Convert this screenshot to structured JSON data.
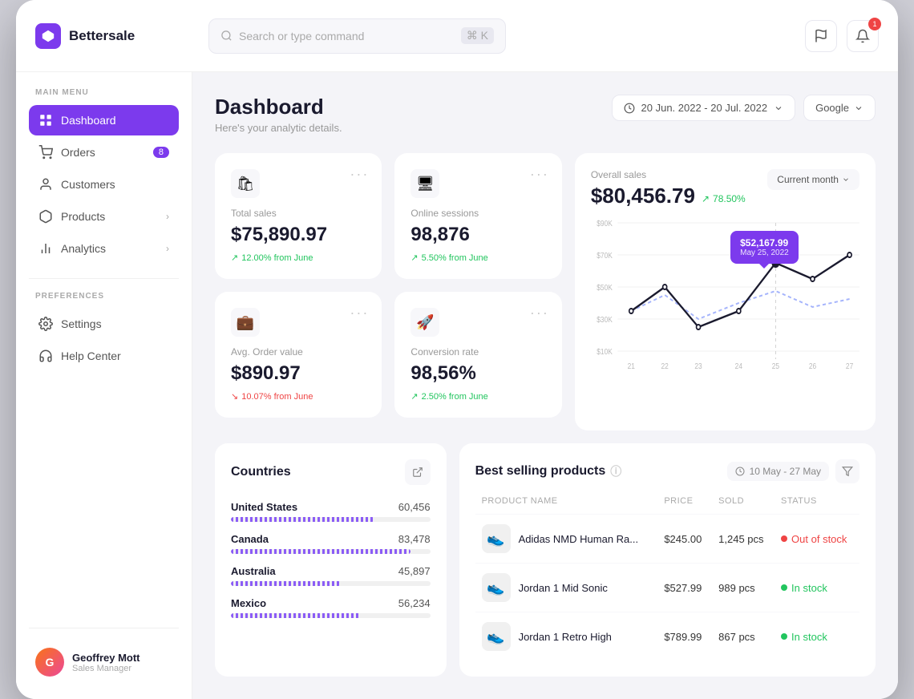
{
  "app": {
    "name": "Bettersale"
  },
  "header": {
    "search_placeholder": "Search or type command",
    "search_shortcut": "⌘ K",
    "date_range": "20 Jun. 2022 - 20 Jul. 2022",
    "source": "Google"
  },
  "sidebar": {
    "main_menu_label": "MAIN MENU",
    "preferences_label": "PREFERENCES",
    "items": [
      {
        "id": "dashboard",
        "label": "Dashboard",
        "active": true,
        "badge": null
      },
      {
        "id": "orders",
        "label": "Orders",
        "active": false,
        "badge": "8"
      },
      {
        "id": "customers",
        "label": "Customers",
        "active": false,
        "badge": null
      },
      {
        "id": "products",
        "label": "Products",
        "active": false,
        "badge": null
      },
      {
        "id": "analytics",
        "label": "Analytics",
        "active": false,
        "badge": null
      }
    ],
    "pref_items": [
      {
        "id": "settings",
        "label": "Settings"
      },
      {
        "id": "help",
        "label": "Help Center"
      }
    ],
    "user": {
      "name": "Geoffrey Mott",
      "role": "Sales Manager"
    }
  },
  "page": {
    "title": "Dashboard",
    "subtitle": "Here's your analytic details."
  },
  "stats": [
    {
      "id": "total-sales",
      "label": "Total sales",
      "value": "$75,890.97",
      "change": "12.00% from June",
      "direction": "up",
      "icon": "🛍"
    },
    {
      "id": "online-sessions",
      "label": "Online sessions",
      "value": "98,876",
      "change": "5.50% from June",
      "direction": "up",
      "icon": "🖥"
    },
    {
      "id": "avg-order",
      "label": "Avg. Order value",
      "value": "$890.97",
      "change": "10.07% from June",
      "direction": "down",
      "icon": "💼"
    },
    {
      "id": "conversion",
      "label": "Conversion rate",
      "value": "98,56%",
      "change": "2.50% from June",
      "direction": "up",
      "icon": "🚀"
    }
  ],
  "overall_sales": {
    "label": "Overall sales",
    "value": "$80,456.79",
    "change": "78.50%",
    "period": "Current month",
    "tooltip_value": "$52,167.99",
    "tooltip_date": "May 25, 2022",
    "y_labels": [
      "$90K",
      "$70K",
      "$50K",
      "$30K",
      "$10K"
    ],
    "x_labels": [
      "21",
      "22",
      "23",
      "24",
      "25",
      "26",
      "27"
    ]
  },
  "countries": {
    "title": "Countries",
    "items": [
      {
        "name": "United States",
        "value": "60,456",
        "pct": 72
      },
      {
        "name": "Canada",
        "value": "83,478",
        "pct": 90
      },
      {
        "name": "Australia",
        "value": "45,897",
        "pct": 55
      },
      {
        "name": "Mexico",
        "value": "56,234",
        "pct": 65
      }
    ]
  },
  "products": {
    "title": "Best selling products",
    "date_range": "10 May - 27 May",
    "columns": [
      "Product name",
      "Price",
      "Sold",
      "Status"
    ],
    "items": [
      {
        "name": "Adidas NMD Human Ra...",
        "price": "$245.00",
        "sold": "1,245 pcs",
        "status": "Out of stock",
        "status_type": "out",
        "icon": "👟"
      },
      {
        "name": "Jordan 1 Mid Sonic",
        "price": "$527.99",
        "sold": "989 pcs",
        "status": "In stock",
        "status_type": "in",
        "icon": "👟"
      },
      {
        "name": "Jordan 1 Retro High",
        "price": "$789.99",
        "sold": "867 pcs",
        "status": "In stock",
        "status_type": "in",
        "icon": "👟"
      }
    ]
  }
}
